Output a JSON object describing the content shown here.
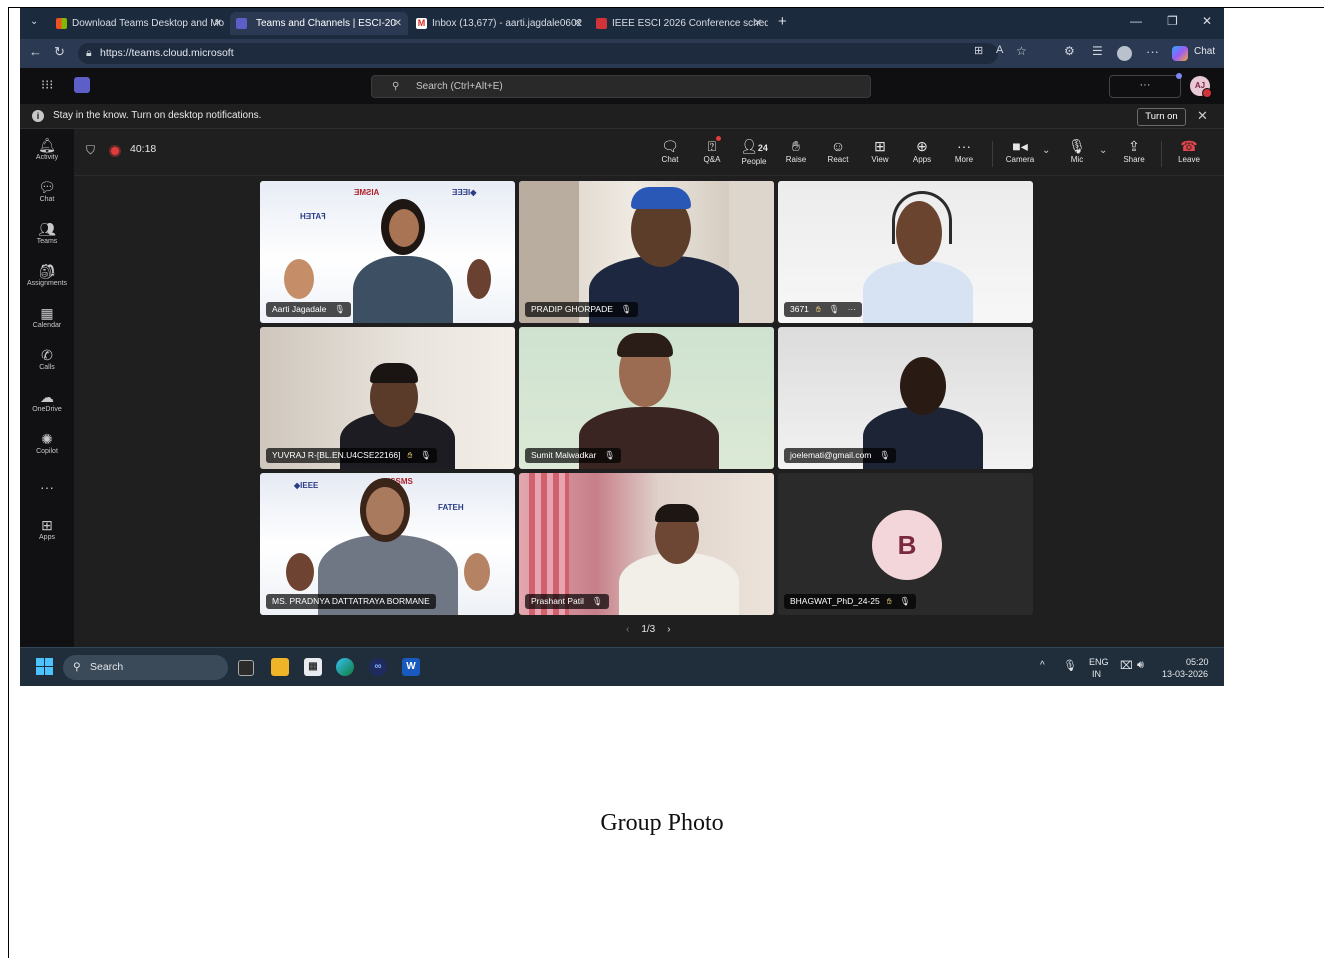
{
  "browser": {
    "tabs": [
      {
        "label": "Download Teams Desktop and Mo",
        "active": false
      },
      {
        "label": "Teams and Channels | ESCI-20",
        "active": true
      },
      {
        "label": "Inbox (13,677) - aarti.jagdale0602",
        "active": false
      },
      {
        "label": "IEEE ESCI 2026 Conference schedu",
        "active": false
      }
    ],
    "url": "https://teams.cloud.microsoft",
    "copilot_label": "Chat"
  },
  "teams": {
    "search_placeholder": "Search (Ctrl+Alt+E)",
    "avatar_initials": "AJ",
    "more": "···"
  },
  "notification": {
    "text": "Stay in the know. Turn on desktop notifications.",
    "button": "Turn on"
  },
  "rail": [
    {
      "icon": "bell-icon",
      "label": "Activity"
    },
    {
      "icon": "chat-icon",
      "label": "Chat"
    },
    {
      "icon": "teams-icon",
      "label": "Teams"
    },
    {
      "icon": "assignments-icon",
      "label": "Assignments"
    },
    {
      "icon": "calendar-icon",
      "label": "Calendar"
    },
    {
      "icon": "calls-icon",
      "label": "Calls"
    },
    {
      "icon": "onedrive-icon",
      "label": "OneDrive"
    },
    {
      "icon": "copilot-icon",
      "label": "Copilot"
    },
    {
      "icon": "more-icon",
      "label": ""
    },
    {
      "icon": "apps-icon",
      "label": "Apps"
    }
  ],
  "meeting": {
    "timer": "40:18",
    "people_count": "24",
    "controls": {
      "chat": "Chat",
      "qa": "Q&A",
      "people": "People",
      "raise": "Raise",
      "react": "React",
      "view": "View",
      "apps": "Apps",
      "more": "More",
      "camera": "Camera",
      "mic": "Mic",
      "share": "Share",
      "leave": "Leave"
    },
    "participants": [
      {
        "name": "Aarti Jagadale",
        "hand": false
      },
      {
        "name": "PRADIP GHORPADE",
        "hand": false
      },
      {
        "name": "3671",
        "hand": true
      },
      {
        "name": "YUVRAJ R-[BL.EN.U4CSE22166]",
        "hand": true
      },
      {
        "name": "Sumit Malwadkar",
        "hand": false
      },
      {
        "name": "joelemati@gmail.com",
        "hand": false
      },
      {
        "name": "MS. PRADNYA DATTATRAYA BORMANE",
        "hand": false
      },
      {
        "name": "Prashant Patil",
        "hand": false
      },
      {
        "name": "BHAGWAT_PhD_24-25",
        "hand": true,
        "initial": "B"
      }
    ],
    "page": "1/3"
  },
  "taskbar": {
    "search": "Search",
    "lang": "ENG",
    "region": "IN",
    "time": "05:20",
    "date": "13-03-2026"
  },
  "caption": "Group Photo",
  "colors": {
    "accent": "#5b5fc7",
    "record": "#e03c3c",
    "leave": "#e0464b"
  }
}
